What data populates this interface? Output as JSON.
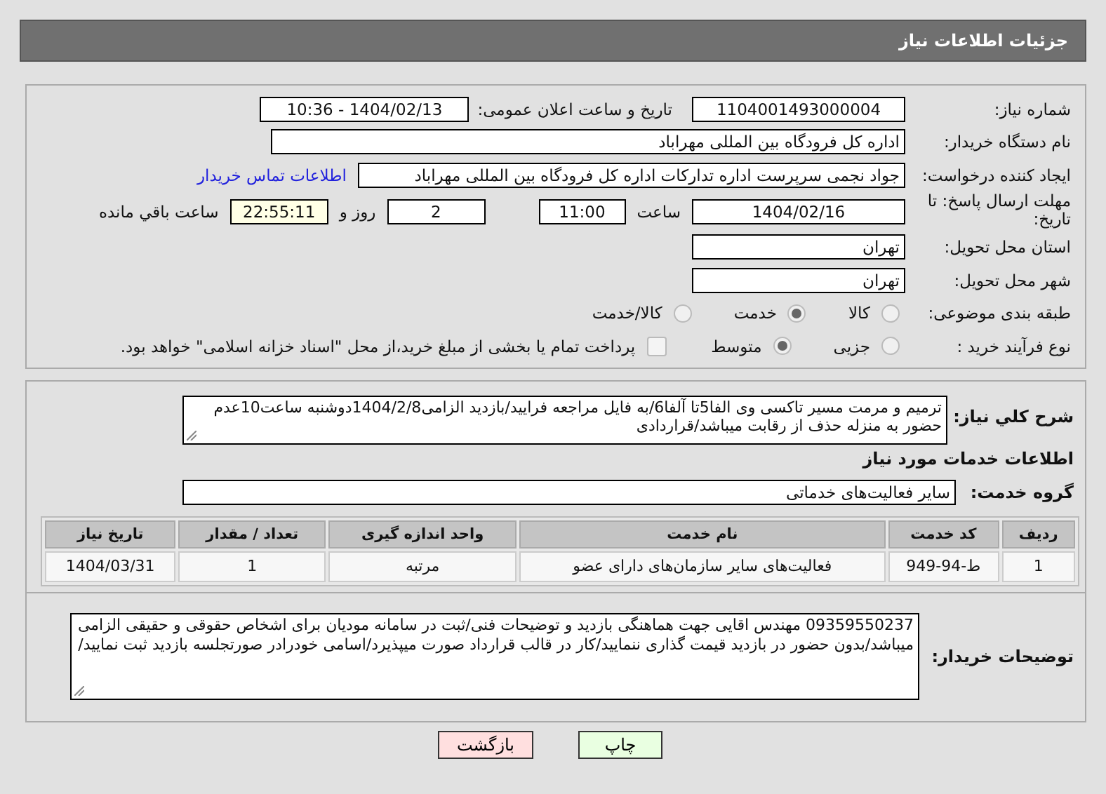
{
  "header": {
    "title": "جزئیات اطلاعات نیاز"
  },
  "need_number": {
    "label": "شماره نیاز:",
    "value": "1104001493000004"
  },
  "announce": {
    "label": "تاریخ و ساعت اعلان عمومی:",
    "value": "1404/02/13 - 10:36"
  },
  "buyer_org": {
    "label": "نام دستگاه خریدار:",
    "value": "اداره کل فرودگاه بین المللی مهراباد"
  },
  "requester": {
    "label": "ایجاد کننده درخواست:",
    "value": "جواد نجمی سرپرست اداره تدارکات  اداره کل فرودگاه بین المللی مهراباد",
    "link": "اطلاعات تماس خریدار"
  },
  "deadline": {
    "label": "مهلت ارسال پاسخ: تا تاریخ:",
    "date": "1404/02/16",
    "time_label": "ساعت",
    "time": "11:00",
    "days": "2",
    "days_label": "روز و",
    "remaining": "22:55:11",
    "remaining_label": "ساعت باقي مانده"
  },
  "province": {
    "label": "استان محل تحویل:",
    "value": "تهران"
  },
  "city": {
    "label": "شهر محل تحویل:",
    "value": "تهران"
  },
  "category": {
    "label": "طبقه بندی موضوعی:",
    "options": [
      {
        "label": "کالا",
        "selected": false
      },
      {
        "label": "خدمت",
        "selected": true
      },
      {
        "label": "کالا/خدمت",
        "selected": false
      }
    ]
  },
  "purchase_type": {
    "label": "نوع فرآیند خرید :",
    "options": [
      {
        "label": "جزیی",
        "selected": false
      },
      {
        "label": "متوسط",
        "selected": true
      }
    ],
    "payment": {
      "checked": false,
      "text": "پرداخت تمام یا بخشی از مبلغ خرید،از محل \"اسناد خزانه اسلامی\" خواهد بود."
    }
  },
  "description": {
    "label": "شرح کلي نياز:",
    "value": "ترمیم و مرمت مسیر تاکسی وی الفا5تا آلفا6/به فایل مراجعه فرایید/بازدید الزامی1404/2/8دوشنبه ساعت10عدم حضور به منزله حذف از رقابت میباشد/قراردادی"
  },
  "services_heading": "اطلاعات خدمات مورد نیاز",
  "service_group": {
    "label": "گروه خدمت:",
    "value": "سایر فعالیت‌های خدماتی"
  },
  "table": {
    "columns": [
      "ردیف",
      "کد خدمت",
      "نام خدمت",
      "واحد اندازه گیری",
      "تعداد / مقدار",
      "تاریخ نیاز"
    ],
    "rows": [
      [
        "1",
        "ط-94-949",
        "فعالیت‌های سایر سازمان‌های دارای عضو",
        "مرتبه",
        "1",
        "1404/03/31"
      ]
    ]
  },
  "buyer_notes": {
    "label": "توضیحات خریدار:",
    "value": "09359550237 مهندس اقایی جهت هماهنگی بازدید و توضیحات فنی/ثبت در سامانه مودیان برای اشخاص حقوقی و حقیقی الزامی میباشد/بدون حضور در بازدید قیمت گذاری ننمایید/کار در قالب قرارداد صورت میپذیرد/اسامی خودرادر صورتجلسه بازدید ثبت نمایید/"
  },
  "buttons": [
    {
      "label": "چاپ",
      "kind": "print"
    },
    {
      "label": "بازگشت",
      "kind": "back"
    }
  ]
}
